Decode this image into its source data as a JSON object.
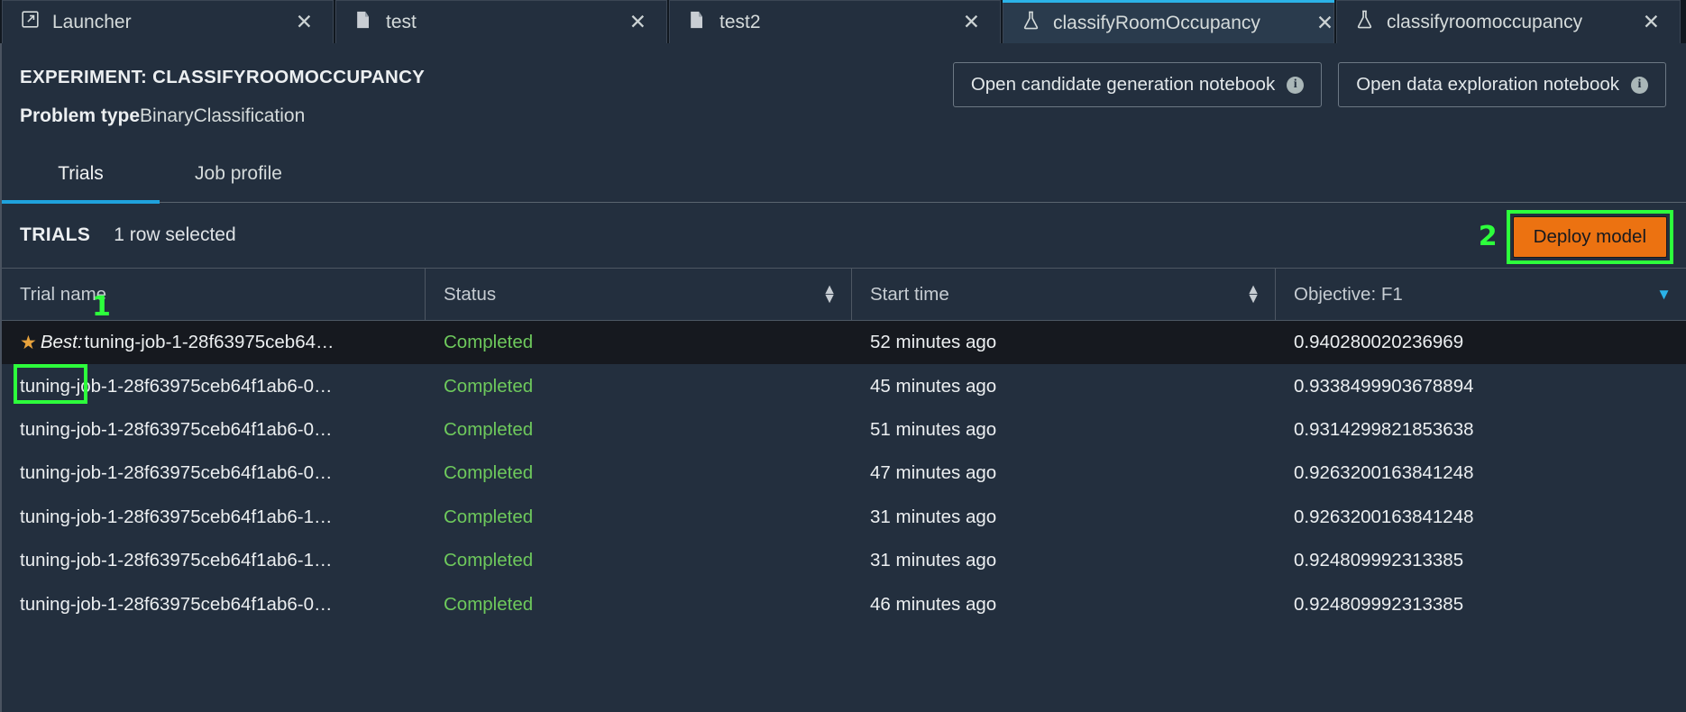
{
  "tabs": [
    {
      "label": "Launcher",
      "icon": "launcher-icon",
      "close": "✕",
      "active": false
    },
    {
      "label": "test",
      "icon": "notebook-icon",
      "close": "✕",
      "active": false
    },
    {
      "label": "test2",
      "icon": "notebook-icon",
      "close": "✕",
      "active": false
    },
    {
      "label": "classifyRoomOccupancy",
      "icon": "flask-icon",
      "close": "✕",
      "active": true
    },
    {
      "label": "classifyroomoccupancy",
      "icon": "flask-icon",
      "close": "✕",
      "active": false
    }
  ],
  "header": {
    "experiment_title": "EXPERIMENT: CLASSIFYROOMOCCUPANCY",
    "problem_type_label": "Problem type",
    "problem_type_value": "BinaryClassification",
    "buttons": [
      {
        "label": "Open candidate generation notebook",
        "info_icon": "info-icon",
        "info_glyph": "i"
      },
      {
        "label": "Open data exploration notebook",
        "info_icon": "info-icon",
        "info_glyph": "i"
      }
    ]
  },
  "subtabs": [
    {
      "label": "Trials",
      "active": true
    },
    {
      "label": "Job profile",
      "active": false
    }
  ],
  "trials_bar": {
    "title": "TRIALS",
    "selection_text": "1 row selected",
    "annotation_number": "2",
    "deploy_label": "Deploy model"
  },
  "table": {
    "columns": [
      {
        "label": "Trial name",
        "sort": "none"
      },
      {
        "label": "Status",
        "sort": "sortable"
      },
      {
        "label": "Start time",
        "sort": "sortable"
      },
      {
        "label": "Objective: F1",
        "sort": "desc"
      }
    ],
    "sort_glyphs": {
      "up": "▲",
      "down": "▼"
    },
    "row_annotation_number": "1",
    "best_star": "★",
    "best_word": "Best:",
    "rows": [
      {
        "name": "tuning-job-1-28f63975ceb64…",
        "best": true,
        "selected": true,
        "status": "Completed",
        "start_time": "52 minutes ago",
        "objective": "0.940280020236969"
      },
      {
        "name": "tuning-job-1-28f63975ceb64f1ab6-0…",
        "best": false,
        "selected": false,
        "status": "Completed",
        "start_time": "45 minutes ago",
        "objective": "0.9338499903678894"
      },
      {
        "name": "tuning-job-1-28f63975ceb64f1ab6-0…",
        "best": false,
        "selected": false,
        "status": "Completed",
        "start_time": "51 minutes ago",
        "objective": "0.9314299821853638"
      },
      {
        "name": "tuning-job-1-28f63975ceb64f1ab6-0…",
        "best": false,
        "selected": false,
        "status": "Completed",
        "start_time": "47 minutes ago",
        "objective": "0.9263200163841248"
      },
      {
        "name": "tuning-job-1-28f63975ceb64f1ab6-1…",
        "best": false,
        "selected": false,
        "status": "Completed",
        "start_time": "31 minutes ago",
        "objective": "0.9263200163841248"
      },
      {
        "name": "tuning-job-1-28f63975ceb64f1ab6-1…",
        "best": false,
        "selected": false,
        "status": "Completed",
        "start_time": "31 minutes ago",
        "objective": "0.924809992313385"
      },
      {
        "name": "tuning-job-1-28f63975ceb64f1ab6-0…",
        "best": false,
        "selected": false,
        "status": "Completed",
        "start_time": "46 minutes ago",
        "objective": "0.924809992313385"
      }
    ]
  },
  "colors": {
    "accent_blue": "#2bb3e8",
    "status_green": "#6ec95c",
    "annotation_green": "#2dff3c",
    "deploy_orange": "#ec7211",
    "star_gold": "#e8a33d"
  }
}
